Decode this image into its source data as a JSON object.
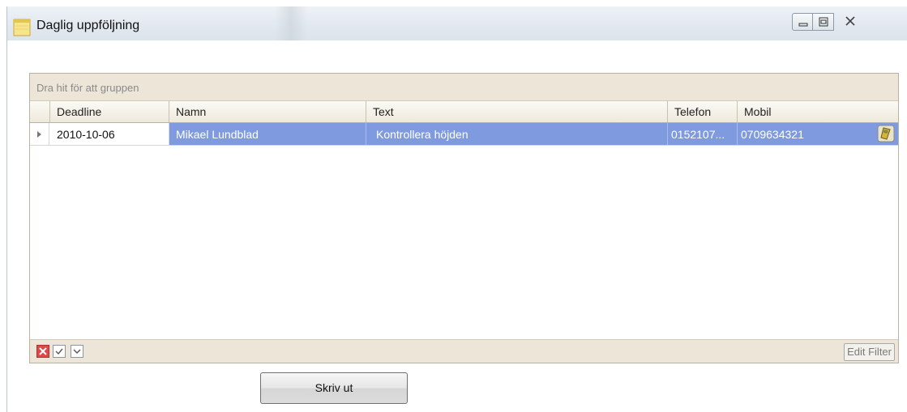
{
  "window": {
    "title": "Daglig uppföljning"
  },
  "grid": {
    "group_hint": "Dra hit för att gruppen",
    "columns": [
      "Deadline",
      "Namn",
      "Text",
      "Telefon",
      "Mobil"
    ],
    "rows": [
      {
        "deadline": "2010-10-06",
        "namn": "Mikael Lundblad",
        "text": "Kontrollera höjden",
        "telefon": "0152107...",
        "mobil": "0709634321",
        "icon": "mobile-phone-icon"
      }
    ],
    "selection_color": "#7f9ade",
    "footer": {
      "edit_filter_label": "Edit Filter"
    }
  },
  "actions": {
    "print_label": "Skriv ut"
  }
}
